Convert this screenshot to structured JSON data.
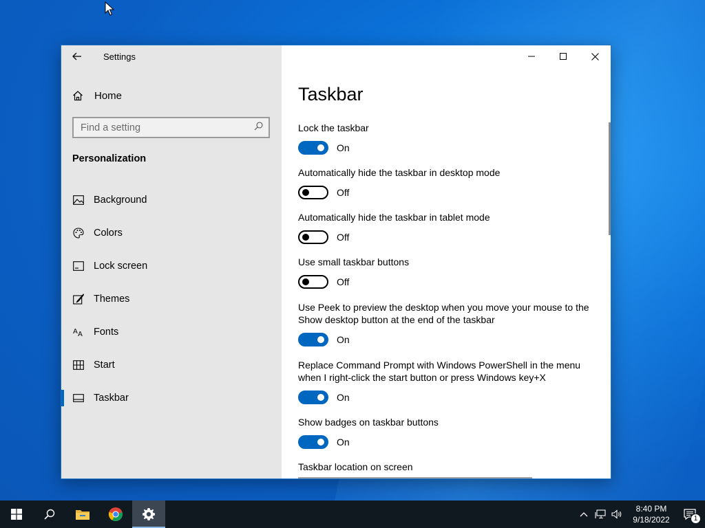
{
  "window": {
    "title": "Settings"
  },
  "sidebar": {
    "home_label": "Home",
    "search_placeholder": "Find a setting",
    "section_heading": "Personalization",
    "items": [
      {
        "label": "Background",
        "icon": "image-icon"
      },
      {
        "label": "Colors",
        "icon": "palette-icon"
      },
      {
        "label": "Lock screen",
        "icon": "lock-screen-icon"
      },
      {
        "label": "Themes",
        "icon": "themes-brush-icon"
      },
      {
        "label": "Fonts",
        "icon": "fonts-icon"
      },
      {
        "label": "Start",
        "icon": "start-layout-icon"
      },
      {
        "label": "Taskbar",
        "icon": "taskbar-icon",
        "active": true
      }
    ]
  },
  "main": {
    "page_title": "Taskbar",
    "settings": [
      {
        "label": "Lock the taskbar",
        "state": "On",
        "on": true
      },
      {
        "label": "Automatically hide the taskbar in desktop mode",
        "state": "Off",
        "on": false
      },
      {
        "label": "Automatically hide the taskbar in tablet mode",
        "state": "Off",
        "on": false
      },
      {
        "label": "Use small taskbar buttons",
        "state": "Off",
        "on": false
      },
      {
        "label": "Use Peek to preview the desktop when you move your mouse to the Show desktop button at the end of the taskbar",
        "state": "On",
        "on": true
      },
      {
        "label": "Replace Command Prompt with Windows PowerShell in the menu when I right-click the start button or press Windows key+X",
        "state": "On",
        "on": true
      },
      {
        "label": "Show badges on taskbar buttons",
        "state": "On",
        "on": true
      }
    ],
    "location_label": "Taskbar location on screen"
  },
  "taskbar": {
    "apps": [
      "start-windows-icon",
      "search-icon",
      "file-explorer-icon",
      "chrome-icon",
      "settings-gear-icon"
    ],
    "time": "8:40 PM",
    "date": "9/18/2022",
    "notification_count": "1"
  },
  "colors": {
    "accent": "#0067c0",
    "sidebar_bg": "#e6e6e6",
    "taskbar_bg": "#101820"
  }
}
